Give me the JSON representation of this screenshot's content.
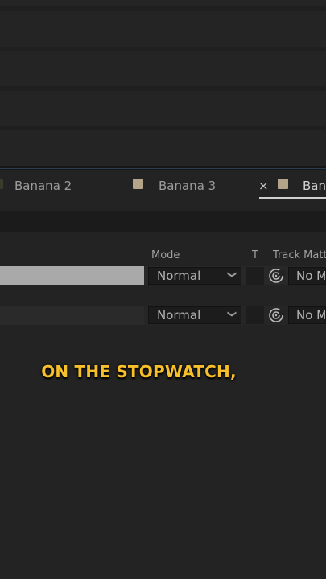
{
  "tabs": [
    {
      "label": "Banana 2"
    },
    {
      "label": "Banana 3"
    },
    {
      "label": "Ban",
      "active": true,
      "close_glyph": "×"
    }
  ],
  "colors": {
    "label_swatch": "#b3a48a",
    "caption": "#f7c02a",
    "panel_bg": "#232323"
  },
  "columns": {
    "mode": "Mode",
    "t": "T",
    "track_matte": "Track Matte"
  },
  "layers": [
    {
      "mode": "Normal",
      "track_matte": "No M",
      "selected": true
    },
    {
      "mode": "Normal",
      "track_matte": "No M",
      "selected": false
    }
  ],
  "icons": {
    "dropdown": "chevron-down-icon",
    "track_matte": "spiral-icon"
  },
  "caption": "ON THE STOPWATCH,"
}
